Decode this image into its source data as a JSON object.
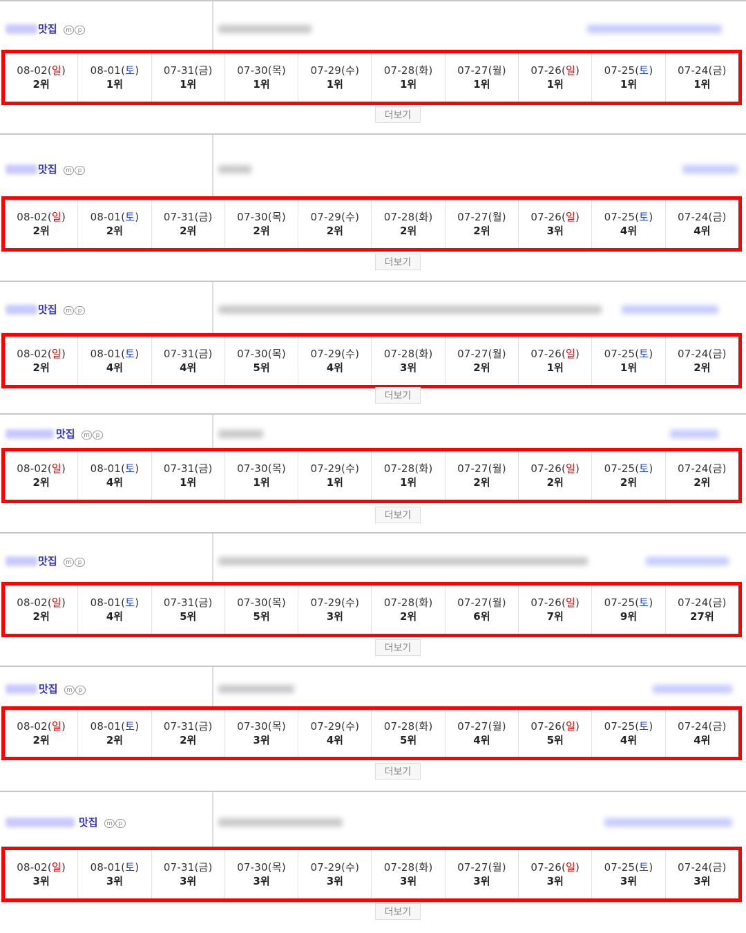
{
  "more_label": "더보기",
  "mp_icons": [
    "m",
    "p"
  ],
  "blocks": [
    {
      "keyword_suffix": "맛집",
      "days": [
        {
          "date": "08-02(",
          "day": "일",
          "close": ")",
          "rank": "2위"
        },
        {
          "date": "08-01(",
          "day": "토",
          "close": ")",
          "rank": "1위"
        },
        {
          "date": "07-31(",
          "day": "금",
          "close": ")",
          "rank": "1위"
        },
        {
          "date": "07-30(",
          "day": "목",
          "close": ")",
          "rank": "1위"
        },
        {
          "date": "07-29(",
          "day": "수",
          "close": ")",
          "rank": "1위"
        },
        {
          "date": "07-28(",
          "day": "화",
          "close": ")",
          "rank": "1위"
        },
        {
          "date": "07-27(",
          "day": "월",
          "close": ")",
          "rank": "1위"
        },
        {
          "date": "07-26(",
          "day": "일",
          "close": ")",
          "rank": "1위"
        },
        {
          "date": "07-25(",
          "day": "토",
          "close": ")",
          "rank": "1위"
        },
        {
          "date": "07-24(",
          "day": "금",
          "close": ")",
          "rank": "1위"
        }
      ]
    },
    {
      "keyword_suffix": "맛집",
      "days": [
        {
          "date": "08-02(",
          "day": "일",
          "close": ")",
          "rank": "2위"
        },
        {
          "date": "08-01(",
          "day": "토",
          "close": ")",
          "rank": "2위"
        },
        {
          "date": "07-31(",
          "day": "금",
          "close": ")",
          "rank": "2위"
        },
        {
          "date": "07-30(",
          "day": "목",
          "close": ")",
          "rank": "2위"
        },
        {
          "date": "07-29(",
          "day": "수",
          "close": ")",
          "rank": "2위"
        },
        {
          "date": "07-28(",
          "day": "화",
          "close": ")",
          "rank": "2위"
        },
        {
          "date": "07-27(",
          "day": "월",
          "close": ")",
          "rank": "2위"
        },
        {
          "date": "07-26(",
          "day": "일",
          "close": ")",
          "rank": "3위"
        },
        {
          "date": "07-25(",
          "day": "토",
          "close": ")",
          "rank": "4위"
        },
        {
          "date": "07-24(",
          "day": "금",
          "close": ")",
          "rank": "4위"
        }
      ]
    },
    {
      "keyword_suffix": "맛집",
      "days": [
        {
          "date": "08-02(",
          "day": "일",
          "close": ")",
          "rank": "2위"
        },
        {
          "date": "08-01(",
          "day": "토",
          "close": ")",
          "rank": "4위"
        },
        {
          "date": "07-31(",
          "day": "금",
          "close": ")",
          "rank": "4위"
        },
        {
          "date": "07-30(",
          "day": "목",
          "close": ")",
          "rank": "5위"
        },
        {
          "date": "07-29(",
          "day": "수",
          "close": ")",
          "rank": "4위"
        },
        {
          "date": "07-28(",
          "day": "화",
          "close": ")",
          "rank": "3위"
        },
        {
          "date": "07-27(",
          "day": "월",
          "close": ")",
          "rank": "2위"
        },
        {
          "date": "07-26(",
          "day": "일",
          "close": ")",
          "rank": "1위"
        },
        {
          "date": "07-25(",
          "day": "토",
          "close": ")",
          "rank": "1위"
        },
        {
          "date": "07-24(",
          "day": "금",
          "close": ")",
          "rank": "2위"
        }
      ]
    },
    {
      "keyword_suffix": "맛집",
      "days": [
        {
          "date": "08-02(",
          "day": "일",
          "close": ")",
          "rank": "2위"
        },
        {
          "date": "08-01(",
          "day": "토",
          "close": ")",
          "rank": "4위"
        },
        {
          "date": "07-31(",
          "day": "금",
          "close": ")",
          "rank": "1위"
        },
        {
          "date": "07-30(",
          "day": "목",
          "close": ")",
          "rank": "1위"
        },
        {
          "date": "07-29(",
          "day": "수",
          "close": ")",
          "rank": "1위"
        },
        {
          "date": "07-28(",
          "day": "화",
          "close": ")",
          "rank": "1위"
        },
        {
          "date": "07-27(",
          "day": "월",
          "close": ")",
          "rank": "2위"
        },
        {
          "date": "07-26(",
          "day": "일",
          "close": ")",
          "rank": "2위"
        },
        {
          "date": "07-25(",
          "day": "토",
          "close": ")",
          "rank": "2위"
        },
        {
          "date": "07-24(",
          "day": "금",
          "close": ")",
          "rank": "2위"
        }
      ]
    },
    {
      "keyword_suffix": "맛집",
      "days": [
        {
          "date": "08-02(",
          "day": "일",
          "close": ")",
          "rank": "2위"
        },
        {
          "date": "08-01(",
          "day": "토",
          "close": ")",
          "rank": "4위"
        },
        {
          "date": "07-31(",
          "day": "금",
          "close": ")",
          "rank": "5위"
        },
        {
          "date": "07-30(",
          "day": "목",
          "close": ")",
          "rank": "5위"
        },
        {
          "date": "07-29(",
          "day": "수",
          "close": ")",
          "rank": "3위"
        },
        {
          "date": "07-28(",
          "day": "화",
          "close": ")",
          "rank": "2위"
        },
        {
          "date": "07-27(",
          "day": "월",
          "close": ")",
          "rank": "6위"
        },
        {
          "date": "07-26(",
          "day": "일",
          "close": ")",
          "rank": "7위"
        },
        {
          "date": "07-25(",
          "day": "토",
          "close": ")",
          "rank": "9위"
        },
        {
          "date": "07-24(",
          "day": "금",
          "close": ")",
          "rank": "27위"
        }
      ]
    },
    {
      "keyword_suffix": "맛집",
      "days": [
        {
          "date": "08-02(",
          "day": "일",
          "close": ")",
          "rank": "2위"
        },
        {
          "date": "08-01(",
          "day": "토",
          "close": ")",
          "rank": "2위"
        },
        {
          "date": "07-31(",
          "day": "금",
          "close": ")",
          "rank": "2위"
        },
        {
          "date": "07-30(",
          "day": "목",
          "close": ")",
          "rank": "3위"
        },
        {
          "date": "07-29(",
          "day": "수",
          "close": ")",
          "rank": "4위"
        },
        {
          "date": "07-28(",
          "day": "화",
          "close": ")",
          "rank": "5위"
        },
        {
          "date": "07-27(",
          "day": "월",
          "close": ")",
          "rank": "4위"
        },
        {
          "date": "07-26(",
          "day": "일",
          "close": ")",
          "rank": "5위"
        },
        {
          "date": "07-25(",
          "day": "토",
          "close": ")",
          "rank": "4위"
        },
        {
          "date": "07-24(",
          "day": "금",
          "close": ")",
          "rank": "4위"
        }
      ]
    },
    {
      "keyword_suffix": "맛집",
      "days": [
        {
          "date": "08-02(",
          "day": "일",
          "close": ")",
          "rank": "3위"
        },
        {
          "date": "08-01(",
          "day": "토",
          "close": ")",
          "rank": "3위"
        },
        {
          "date": "07-31(",
          "day": "금",
          "close": ")",
          "rank": "3위"
        },
        {
          "date": "07-30(",
          "day": "목",
          "close": ")",
          "rank": "3위"
        },
        {
          "date": "07-29(",
          "day": "수",
          "close": ")",
          "rank": "3위"
        },
        {
          "date": "07-28(",
          "day": "화",
          "close": ")",
          "rank": "3위"
        },
        {
          "date": "07-27(",
          "day": "월",
          "close": ")",
          "rank": "3위"
        },
        {
          "date": "07-26(",
          "day": "일",
          "close": ")",
          "rank": "3위"
        },
        {
          "date": "07-25(",
          "day": "토",
          "close": ")",
          "rank": "3위"
        },
        {
          "date": "07-24(",
          "day": "금",
          "close": ")",
          "rank": "3위"
        }
      ]
    }
  ]
}
